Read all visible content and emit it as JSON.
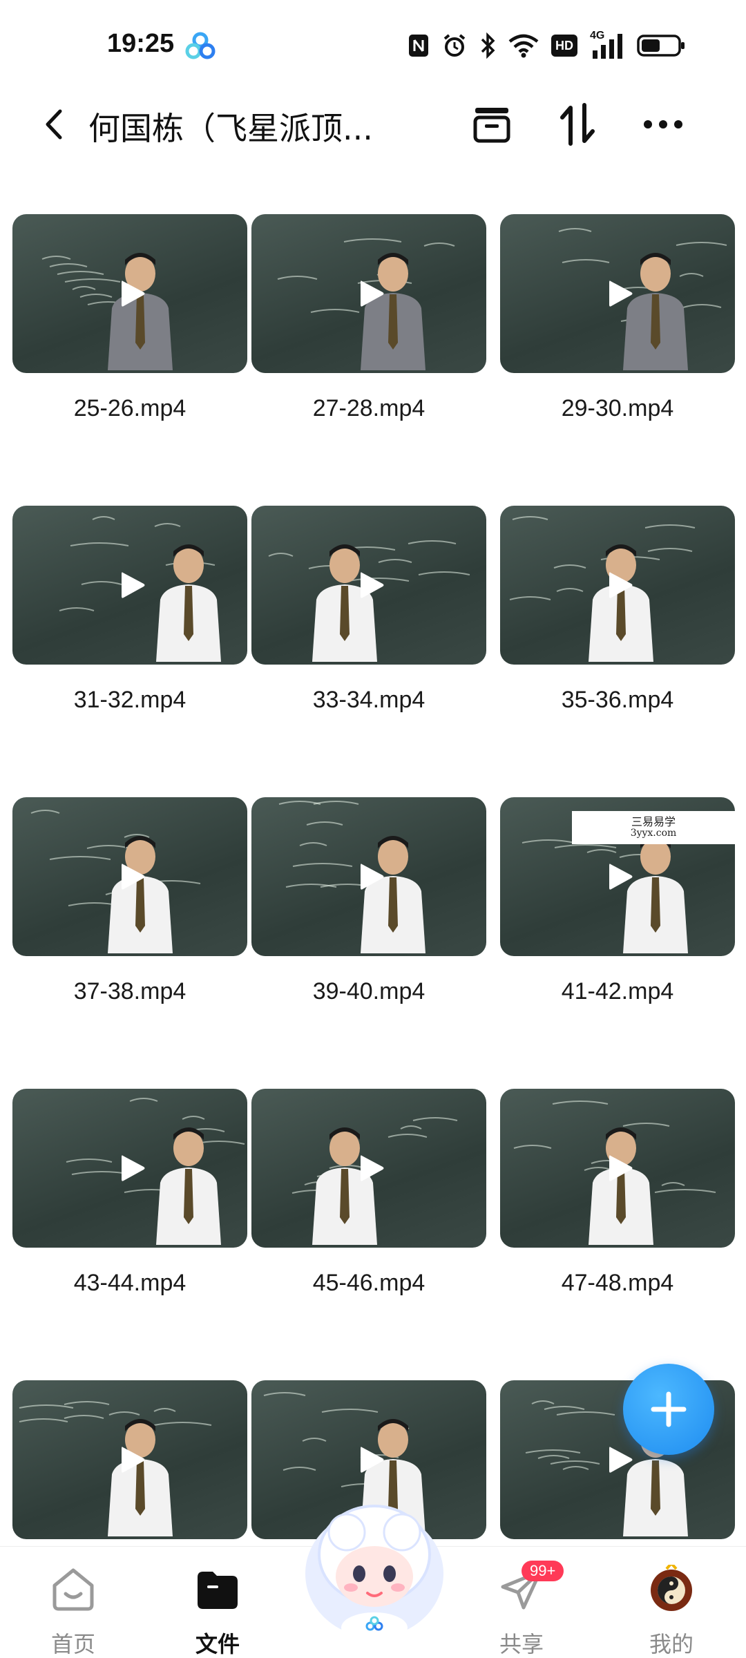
{
  "status_bar": {
    "time": "19:25",
    "icons": [
      "nfc-icon",
      "alarm-icon",
      "bluetooth-icon",
      "wifi-icon",
      "hd-icon",
      "signal-4g-icon",
      "battery-icon"
    ],
    "network_label": "4G",
    "hd_label": "HD"
  },
  "header": {
    "title": "何国栋（飞星派顶...",
    "back_icon": "chevron-left-icon",
    "actions": [
      "archive-icon",
      "sort-icon",
      "more-icon"
    ]
  },
  "files": [
    {
      "name": "25-26.mp4"
    },
    {
      "name": "27-28.mp4"
    },
    {
      "name": "29-30.mp4"
    },
    {
      "name": "31-32.mp4"
    },
    {
      "name": "33-34.mp4"
    },
    {
      "name": "35-36.mp4"
    },
    {
      "name": "37-38.mp4"
    },
    {
      "name": "39-40.mp4"
    },
    {
      "name": "41-42.mp4"
    },
    {
      "name": "43-44.mp4"
    },
    {
      "name": "45-46.mp4"
    },
    {
      "name": "47-48.mp4"
    },
    {
      "name": ""
    },
    {
      "name": ""
    },
    {
      "name": ""
    }
  ],
  "watermark": {
    "line1": "三易易学",
    "line2": "3yyx.com"
  },
  "fab": {
    "icon": "plus-icon"
  },
  "bottom_nav": {
    "items": [
      {
        "label": "首页",
        "icon": "home-icon",
        "active": false
      },
      {
        "label": "文件",
        "icon": "folder-icon",
        "active": true
      },
      {
        "label": "",
        "icon": "mascot-icon",
        "active": false
      },
      {
        "label": "共享",
        "icon": "share-icon",
        "active": false,
        "badge": "99+"
      },
      {
        "label": "我的",
        "icon": "avatar-icon",
        "active": false
      }
    ]
  },
  "colors": {
    "accent": "#1e8cf0",
    "badge": "#ff3a57",
    "thumb_board": "#3a4844"
  }
}
